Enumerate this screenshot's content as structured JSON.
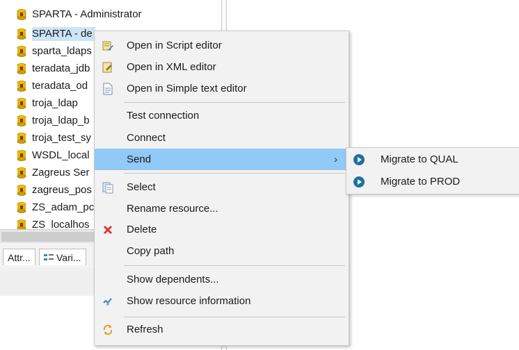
{
  "tree": {
    "items": [
      {
        "label": "SPARTA - Administrator"
      },
      {
        "label": "SPARTA - de"
      },
      {
        "label": "sparta_ldaps"
      },
      {
        "label": "teradata_jdb"
      },
      {
        "label": "teradata_od"
      },
      {
        "label": "troja_ldap"
      },
      {
        "label": "troja_ldap_b"
      },
      {
        "label": "troja_test_sy"
      },
      {
        "label": "WSDL_local"
      },
      {
        "label": "Zagreus Ser"
      },
      {
        "label": "zagreus_pos"
      },
      {
        "label": "ZS_adam_pc"
      },
      {
        "label": "ZS_localhos"
      }
    ],
    "selected_index": 1
  },
  "bottom_tabs": [
    {
      "label": "Attr..."
    },
    {
      "label": "Vari..."
    }
  ],
  "context_menu": {
    "items": [
      {
        "label": "Open in Script editor",
        "icon": "script-editor-icon"
      },
      {
        "label": "Open in XML editor",
        "icon": "xml-editor-icon"
      },
      {
        "label": "Open in Simple text editor",
        "icon": "text-editor-icon"
      },
      {
        "label": "Test connection"
      },
      {
        "label": "Connect"
      },
      {
        "label": "Send",
        "submenu_arrow": "›"
      },
      {
        "label": "Select",
        "icon": "select-icon"
      },
      {
        "label": "Rename resource..."
      },
      {
        "label": "Delete",
        "icon": "delete-icon"
      },
      {
        "label": "Copy path"
      },
      {
        "label": "Show dependents..."
      },
      {
        "label": "Show resource information",
        "icon": "resource-info-icon"
      },
      {
        "label": "Refresh",
        "icon": "refresh-icon"
      }
    ],
    "highlighted": "Send"
  },
  "submenu": {
    "items": [
      {
        "label": "Migrate to QUAL",
        "icon": "play-icon"
      },
      {
        "label": "Migrate to PROD",
        "icon": "play-icon"
      }
    ]
  },
  "colors": {
    "highlight": "#91c9f7",
    "selection": "#cce4f7",
    "db_icon": "#e8b400",
    "play_icon": "#1f6fa3",
    "delete_icon": "#e03030"
  }
}
